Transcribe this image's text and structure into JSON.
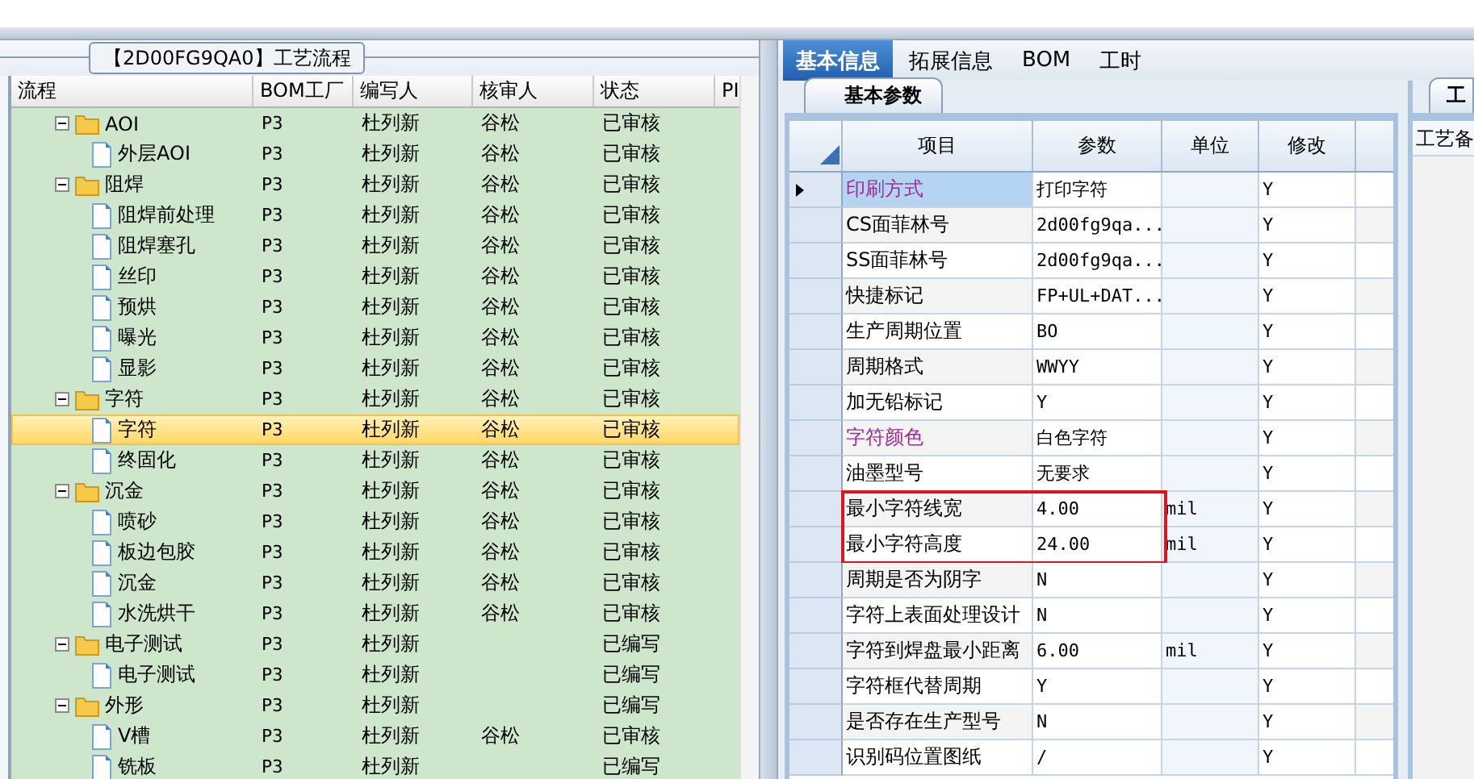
{
  "process_panel": {
    "title": "【2D00FG9QA0】工艺流程"
  },
  "tree": {
    "columns": [
      "流程",
      "BOM工厂",
      "编写人",
      "核审人",
      "状态",
      "PI"
    ],
    "nodes": [
      {
        "label": "AOI",
        "bom": "P3",
        "writer": "杜列新",
        "reviewer": "谷松",
        "status": "已审核",
        "expanded": true,
        "selected": false,
        "children": [
          {
            "label": "外层AOI",
            "bom": "P3",
            "writer": "杜列新",
            "reviewer": "谷松",
            "status": "已审核",
            "selected": false
          }
        ]
      },
      {
        "label": "阻焊",
        "bom": "P3",
        "writer": "杜列新",
        "reviewer": "谷松",
        "status": "已审核",
        "expanded": true,
        "selected": false,
        "children": [
          {
            "label": "阻焊前处理",
            "bom": "P3",
            "writer": "杜列新",
            "reviewer": "谷松",
            "status": "已审核",
            "selected": false
          },
          {
            "label": "阻焊塞孔",
            "bom": "P3",
            "writer": "杜列新",
            "reviewer": "谷松",
            "status": "已审核",
            "selected": false
          },
          {
            "label": "丝印",
            "bom": "P3",
            "writer": "杜列新",
            "reviewer": "谷松",
            "status": "已审核",
            "selected": false
          },
          {
            "label": "预烘",
            "bom": "P3",
            "writer": "杜列新",
            "reviewer": "谷松",
            "status": "已审核",
            "selected": false
          },
          {
            "label": "曝光",
            "bom": "P3",
            "writer": "杜列新",
            "reviewer": "谷松",
            "status": "已审核",
            "selected": false
          },
          {
            "label": "显影",
            "bom": "P3",
            "writer": "杜列新",
            "reviewer": "谷松",
            "status": "已审核",
            "selected": false
          }
        ]
      },
      {
        "label": "字符",
        "bom": "P3",
        "writer": "杜列新",
        "reviewer": "谷松",
        "status": "已审核",
        "expanded": true,
        "selected": false,
        "children": [
          {
            "label": "字符",
            "bom": "P3",
            "writer": "杜列新",
            "reviewer": "谷松",
            "status": "已审核",
            "selected": true
          },
          {
            "label": "终固化",
            "bom": "P3",
            "writer": "杜列新",
            "reviewer": "谷松",
            "status": "已审核",
            "selected": false
          }
        ]
      },
      {
        "label": "沉金",
        "bom": "P3",
        "writer": "杜列新",
        "reviewer": "谷松",
        "status": "已审核",
        "expanded": true,
        "selected": false,
        "children": [
          {
            "label": "喷砂",
            "bom": "P3",
            "writer": "杜列新",
            "reviewer": "谷松",
            "status": "已审核",
            "selected": false
          },
          {
            "label": "板边包胶",
            "bom": "P3",
            "writer": "杜列新",
            "reviewer": "谷松",
            "status": "已审核",
            "selected": false
          },
          {
            "label": "沉金",
            "bom": "P3",
            "writer": "杜列新",
            "reviewer": "谷松",
            "status": "已审核",
            "selected": false
          },
          {
            "label": "水洗烘干",
            "bom": "P3",
            "writer": "杜列新",
            "reviewer": "谷松",
            "status": "已审核",
            "selected": false
          }
        ]
      },
      {
        "label": "电子测试",
        "bom": "P3",
        "writer": "杜列新",
        "status": "已编写",
        "expanded": true,
        "selected": false,
        "children": [
          {
            "label": "电子测试",
            "bom": "P3",
            "writer": "杜列新",
            "status": "已编写",
            "selected": false
          }
        ]
      },
      {
        "label": "外形",
        "bom": "P3",
        "writer": "杜列新",
        "status": "已编写",
        "expanded": true,
        "selected": false,
        "children": [
          {
            "label": "V槽",
            "bom": "P3",
            "writer": "杜列新",
            "reviewer": "谷松",
            "status": "已审核",
            "selected": false
          },
          {
            "label": "铣板",
            "bom": "P3",
            "writer": "杜列新",
            "status": "已编写",
            "selected": false
          }
        ]
      }
    ]
  },
  "tabs": [
    {
      "label": "基本信息",
      "selected": true
    },
    {
      "label": "拓展信息",
      "selected": false
    },
    {
      "label": "BOM",
      "selected": false
    },
    {
      "label": "工时",
      "selected": false
    }
  ],
  "sub_tab": {
    "label": "基本参数"
  },
  "grid": {
    "columns": [
      "项目",
      "参数",
      "单位",
      "修改"
    ],
    "rows": [
      {
        "item": "印刷方式",
        "value": "打印字符",
        "modified": "Y",
        "selected": true,
        "emphasized": true,
        "highlighted": false
      },
      {
        "item": "CS面菲林号",
        "value": "2d00fg9qa...",
        "modified": "Y",
        "selected": false,
        "emphasized": false,
        "highlighted": false
      },
      {
        "item": "SS面菲林号",
        "value": "2d00fg9qa...",
        "modified": "Y",
        "selected": false,
        "emphasized": false,
        "highlighted": false
      },
      {
        "item": "快捷标记",
        "value": "FP+UL+DAT...",
        "modified": "Y",
        "selected": false,
        "emphasized": false,
        "highlighted": false
      },
      {
        "item": "生产周期位置",
        "value": "BO",
        "modified": "Y",
        "selected": false,
        "emphasized": false,
        "highlighted": false
      },
      {
        "item": "周期格式",
        "value": "WWYY",
        "modified": "Y",
        "selected": false,
        "emphasized": false,
        "highlighted": false
      },
      {
        "item": "加无铅标记",
        "value": "Y",
        "modified": "Y",
        "selected": false,
        "emphasized": false,
        "highlighted": false
      },
      {
        "item": "字符颜色",
        "value": "白色字符",
        "modified": "Y",
        "selected": false,
        "emphasized": true,
        "highlighted": false
      },
      {
        "item": "油墨型号",
        "value": "无要求",
        "modified": "Y",
        "selected": false,
        "emphasized": false,
        "highlighted": false
      },
      {
        "item": "最小字符线宽",
        "value": "4.00",
        "unit": "mil",
        "modified": "Y",
        "selected": false,
        "emphasized": false,
        "highlighted": true
      },
      {
        "item": "最小字符高度",
        "value": "24.00",
        "unit": "mil",
        "modified": "Y",
        "selected": false,
        "emphasized": false,
        "highlighted": true
      },
      {
        "item": "周期是否为阴字",
        "value": "N",
        "modified": "Y",
        "selected": false,
        "emphasized": false,
        "highlighted": false
      },
      {
        "item": "字符上表面处理设计",
        "value": "N",
        "modified": "Y",
        "selected": false,
        "emphasized": false,
        "highlighted": false
      },
      {
        "item": "字符到焊盘最小距离",
        "value": "6.00",
        "unit": "mil",
        "modified": "Y",
        "selected": false,
        "emphasized": false,
        "highlighted": false
      },
      {
        "item": "字符框代替周期",
        "value": "Y",
        "modified": "Y",
        "selected": false,
        "emphasized": false,
        "highlighted": false
      },
      {
        "item": "是否存在生产型号",
        "value": "N",
        "modified": "Y",
        "selected": false,
        "emphasized": false,
        "highlighted": false
      },
      {
        "item": "识别码位置图纸",
        "value": "/",
        "modified": "Y",
        "selected": false,
        "emphasized": false,
        "highlighted": false
      }
    ]
  },
  "side_panel": {
    "tab": "工",
    "label": "工艺备"
  }
}
